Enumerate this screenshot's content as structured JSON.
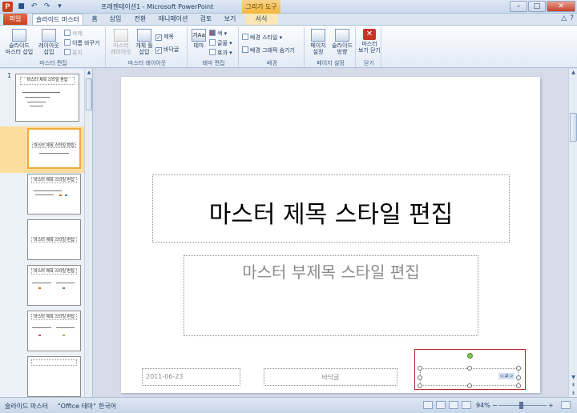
{
  "titlebar": {
    "app_icon": "P",
    "window_title": "프레젠테이션1  -  Microsoft PowerPoint",
    "context_tool": "그리기 도구",
    "qat_icons": [
      "save-icon",
      "undo-icon",
      "redo-icon",
      "customize-icon"
    ],
    "minimize": "–",
    "maximize": "□",
    "close": "✕"
  },
  "tabs": [
    {
      "label": "파일"
    },
    {
      "label": "슬라이드 마스터"
    },
    {
      "label": "홈"
    },
    {
      "label": "삽입"
    },
    {
      "label": "전환"
    },
    {
      "label": "애니메이션"
    },
    {
      "label": "검토"
    },
    {
      "label": "보기"
    },
    {
      "label": "서식"
    }
  ],
  "help": {
    "minimize_ribbon": "△",
    "help": "?"
  },
  "ribbon": {
    "edit_master": {
      "label": "마스터 편집",
      "insert_slide_master": "슬라이드\n마스터 삽입",
      "insert_layout": "레이아웃\n삽입",
      "delete": "삭제",
      "rename": "이름 바꾸기",
      "preserve": "유지"
    },
    "master_layout": {
      "label": "마스터 레이아웃",
      "master_layout_btn": "마스터\n레이아웃",
      "insert_placeholder": "개체 틀\n삽입",
      "title_cb": "제목",
      "footers_cb": "바닥글"
    },
    "edit_theme": {
      "label": "테마 편집",
      "themes": "테마",
      "theme_icon_text": "가Aa",
      "colors": "색",
      "fonts": "글꼴",
      "effects": "효과"
    },
    "background": {
      "label": "배경",
      "background_styles": "배경 스타일",
      "hide_bg_graphics": "배경 그래픽 숨기기"
    },
    "page_setup": {
      "label": "페이지 설정",
      "page_setup": "페이지\n설정",
      "slide_orientation": "슬라이드\n방향"
    },
    "close": {
      "label": "닫기",
      "close_master_view": "마스터\n보기 닫기"
    }
  },
  "thumbnails": [
    {
      "num": "1",
      "title": "마스터 제목 스타일 편집"
    },
    {
      "num": "",
      "title": "마스터 제목 스타일 편집"
    },
    {
      "num": "",
      "title": "마스터 제목 스타일 편집"
    },
    {
      "num": "",
      "title": "마스터 제목 스타일 편집"
    },
    {
      "num": "",
      "title": "마스터 제목 스타일 편집"
    },
    {
      "num": "",
      "title": "마스터 제목 스타일 편집"
    },
    {
      "num": "",
      "title": ""
    }
  ],
  "slide": {
    "title": "마스터 제목 스타일 편집",
    "subtitle": "마스터 부제목 스타일 편집",
    "date": "2011-06-23",
    "footer": "바닥글",
    "page_number": "<#>"
  },
  "statusbar": {
    "view": "슬라이드 마스터",
    "theme": "\"Office 테마\"",
    "language": "한국어",
    "zoom": "94%",
    "zoom_out": "−",
    "zoom_in": "+"
  },
  "colors": {
    "file_tab": "#c8431f",
    "context_tab": "#f1b53a",
    "selection_border": "#b3272c",
    "thumb_selected": "#f2a93b"
  }
}
